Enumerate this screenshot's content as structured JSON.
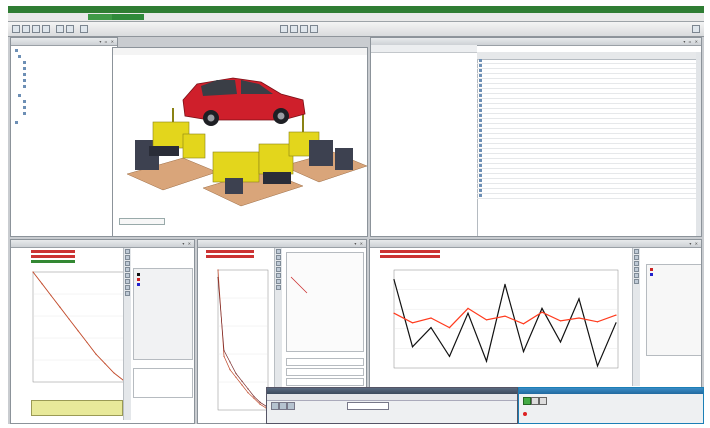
{
  "window": {
    "title": "",
    "accent": "#2f7d33"
  },
  "tabs": [
    {
      "label": "",
      "active": true
    },
    {
      "label": "",
      "active": false
    }
  ],
  "main_view": {
    "header": "",
    "model": "vehicle on test rig"
  },
  "colors": {
    "car_body": "#cf1f2b",
    "rig_yellow": "#e3d61c",
    "signal_black": "#111111",
    "signal_red": "#ff3b1e",
    "chart_grid": "#e2e2e2"
  },
  "chart_data": [
    {
      "type": "line",
      "title": "",
      "series": [
        {
          "values": [
            100,
            90,
            80,
            70,
            60,
            50,
            40,
            30,
            22,
            14,
            8
          ]
        }
      ],
      "x": [
        0,
        1,
        2,
        3,
        4,
        5,
        6,
        7,
        8,
        9,
        10
      ],
      "xlabel": "",
      "ylabel": ""
    },
    {
      "type": "line",
      "title": "",
      "series": [
        {
          "values": [
            100,
            55,
            48,
            44,
            40,
            36,
            33,
            30,
            28
          ]
        },
        {
          "values": [
            96,
            58,
            52,
            46,
            42,
            38,
            34,
            31,
            29
          ]
        }
      ],
      "x": [
        0,
        1,
        2,
        3,
        4,
        5,
        6,
        7,
        8
      ]
    },
    {
      "type": "line",
      "title": "",
      "series": [
        {
          "values": [
            90,
            20,
            40,
            10,
            55,
            5,
            85,
            15,
            60,
            25,
            70,
            0,
            45
          ]
        },
        {
          "values": [
            55,
            45,
            50,
            40,
            60,
            48,
            52,
            44,
            56,
            47,
            50,
            46,
            53
          ]
        }
      ],
      "x": [
        0,
        1,
        2,
        3,
        4,
        5,
        6,
        7,
        8,
        9,
        10,
        11,
        12
      ],
      "ylim": [
        0,
        100
      ]
    }
  ]
}
